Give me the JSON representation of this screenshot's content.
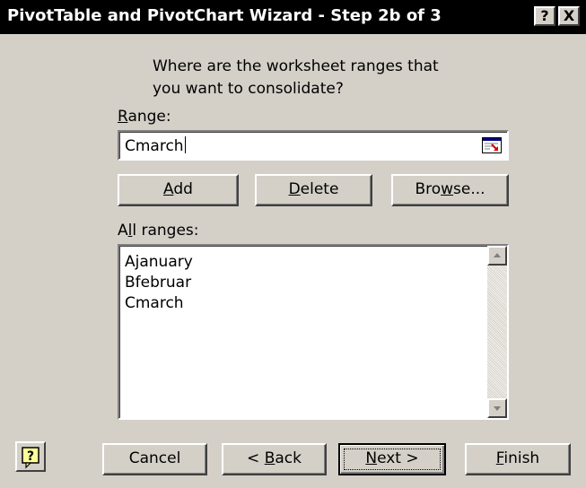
{
  "window": {
    "title": "PivotTable and PivotChart Wizard - Step 2b of 3",
    "help_button": "?",
    "close_button": "X"
  },
  "prompt": {
    "line1": "Where are the worksheet ranges that",
    "line2": "you want to consolidate?"
  },
  "range": {
    "label_mnemonic": "R",
    "label_rest": "ange:",
    "value": "Cmarch",
    "collapse_icon": "collapse-dialog-icon"
  },
  "range_buttons": {
    "add_mnemonic": "A",
    "add_rest": "dd",
    "delete_mnemonic": "D",
    "delete_rest": "elete",
    "browse_pre": "Bro",
    "browse_mnemonic": "w",
    "browse_post": "se..."
  },
  "all_ranges": {
    "label_pre": "A",
    "label_mnemonic": "l",
    "label_rest": "l ranges:",
    "items": [
      "Ajanuary",
      "Bfebruar",
      "Cmarch"
    ]
  },
  "footer": {
    "help_icon": "help-question-icon",
    "cancel": "Cancel",
    "back_pre": "< ",
    "back_mnemonic": "B",
    "back_rest": "ack",
    "next_mnemonic": "N",
    "next_rest": "ext >",
    "finish_mnemonic": "F",
    "finish_rest": "inish"
  }
}
